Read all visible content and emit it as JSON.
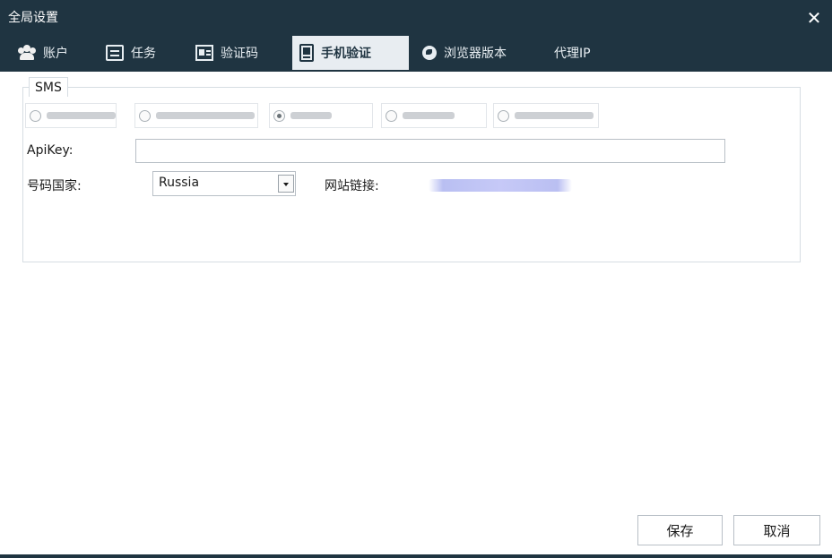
{
  "window": {
    "title": "全局设置",
    "close_symbol": "✕"
  },
  "tabs": [
    {
      "label": "账户",
      "icon": "users-icon"
    },
    {
      "label": "任务",
      "icon": "card-icon"
    },
    {
      "label": "验证码",
      "icon": "id-card-icon"
    },
    {
      "label": "手机验证",
      "icon": "phone-doc-icon",
      "active": true
    },
    {
      "label": "浏览器版本",
      "icon": "globe-icon"
    },
    {
      "label": "代理IP",
      "icon": ""
    }
  ],
  "sms": {
    "group_label": "SMS",
    "providers": [
      {
        "label": "",
        "checked": false
      },
      {
        "label": "",
        "checked": false
      },
      {
        "label": "",
        "checked": true
      },
      {
        "label": "",
        "checked": false
      },
      {
        "label": "",
        "checked": false
      }
    ],
    "apikey_label": "ApiKey:",
    "apikey_value": "",
    "country_label": "号码国家:",
    "country_value": "Russia",
    "site_label": "网站链接:",
    "site_value": ""
  },
  "footer": {
    "save_label": "保存",
    "cancel_label": "取消"
  },
  "colors": {
    "titlebar": "#1f3441",
    "active_tab": "#e8edf1"
  }
}
